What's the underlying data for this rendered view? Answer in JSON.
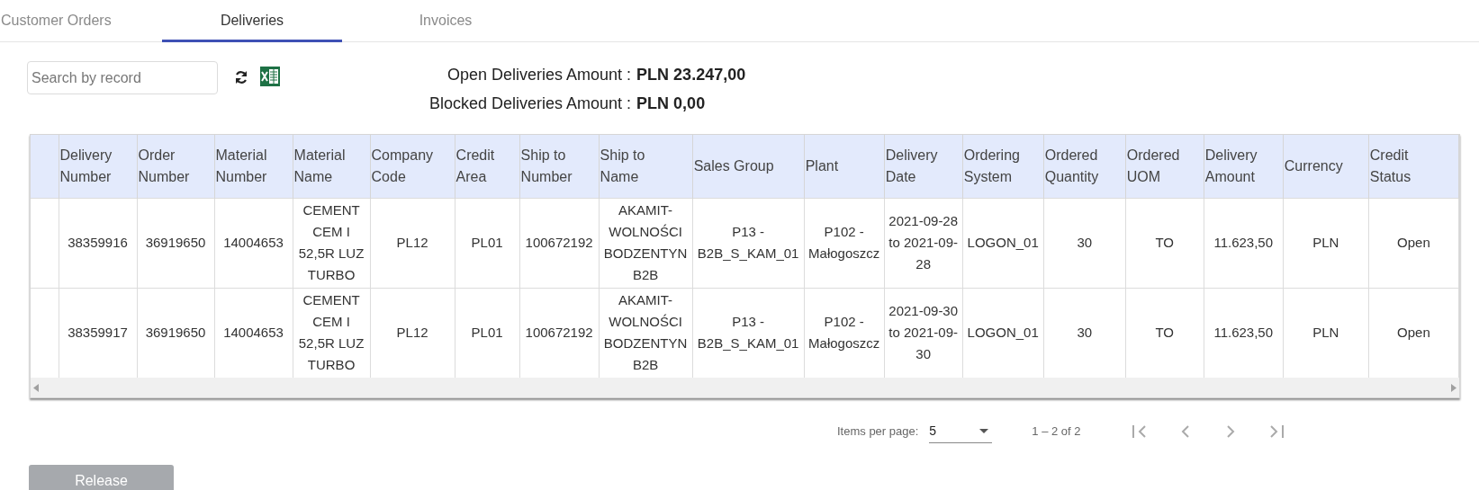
{
  "tabs": [
    {
      "label": "Customer Orders",
      "selected": false
    },
    {
      "label": "Deliveries",
      "selected": true
    },
    {
      "label": "Invoices",
      "selected": false
    }
  ],
  "search": {
    "placeholder": "Search by record"
  },
  "summary": [
    {
      "label": "Open Deliveries Amount :",
      "value": "PLN 23.247,00"
    },
    {
      "label": "Blocked Deliveries Amount :",
      "value": "PLN 0,00"
    }
  ],
  "table": {
    "columns": [
      "Delivery Number",
      "Order Number",
      "Material Number",
      "Material Name",
      "Company Code",
      "Credit Area",
      "Ship to Number",
      "Ship to Name",
      "Sales Group",
      "Plant",
      "Delivery Date",
      "Ordering System",
      "Ordered Quantity",
      "Ordered UOM",
      "Delivery Amount",
      "Currency",
      "Credit Status"
    ],
    "rows": [
      [
        "38359916",
        "36919650",
        "14004653",
        "CEMENT CEM I 52,5R LUZ TURBO",
        "PL12",
        "PL01",
        "100672192",
        "AKAMIT-WOLNOŚCI BODZENTYN B2B",
        "P13 - B2B_S_KAM_01",
        "P102 - Małogoszcz",
        "2021-09-28 to 2021-09-28",
        "LOGON_01",
        "30",
        "TO",
        "11.623,50",
        "PLN",
        "Open"
      ],
      [
        "38359917",
        "36919650",
        "14004653",
        "CEMENT CEM I 52,5R LUZ TURBO",
        "PL12",
        "PL01",
        "100672192",
        "AKAMIT-WOLNOŚCI BODZENTYN B2B",
        "P13 - B2B_S_KAM_01",
        "P102 - Małogoszcz",
        "2021-09-30 to 2021-09-30",
        "LOGON_01",
        "30",
        "TO",
        "11.623,50",
        "PLN",
        "Open"
      ]
    ]
  },
  "pagination": {
    "label": "Items per page:",
    "page_size": "5",
    "range": "1 – 2 of 2"
  },
  "release_button": {
    "label": "Release",
    "disabled": true
  }
}
